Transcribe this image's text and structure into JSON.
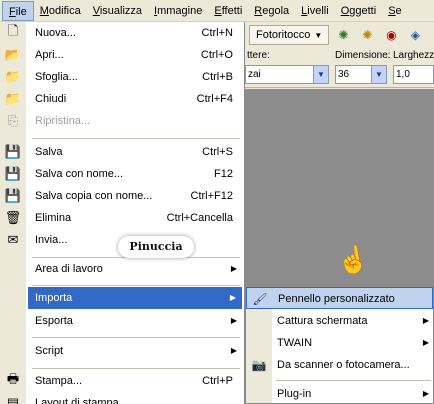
{
  "menubar": {
    "items": [
      "File",
      "Modifica",
      "Visualizza",
      "Immagine",
      "Effetti",
      "Regola",
      "Livelli",
      "Oggetti",
      "Se"
    ]
  },
  "toolbar": {
    "preset_dropdown": "Fotoritocco",
    "buttons": [
      "auto-contrast-icon",
      "auto-color-icon",
      "red-eye-icon",
      "clarify-icon"
    ]
  },
  "options_bar": {
    "charset_label": "ttere:",
    "charset_value": "zai",
    "size_label": "Dimensione:",
    "size_value": "36",
    "width_label": "Larghezza",
    "width_value": "1,0"
  },
  "file_menu": {
    "items": [
      {
        "label": "Nuova...",
        "shortcut": "Ctrl+N",
        "icon": "new-document-icon"
      },
      {
        "label": "Apri...",
        "shortcut": "Ctrl+O",
        "icon": "open-folder-icon"
      },
      {
        "label": "Sfoglia...",
        "shortcut": "Ctrl+B",
        "icon": "browse-folder-icon"
      },
      {
        "label": "Chiudi",
        "shortcut": "Ctrl+F4",
        "icon": "close-folder-icon"
      },
      {
        "label": "Ripristina...",
        "shortcut": "",
        "icon": "revert-icon"
      },
      {
        "label": "Salva",
        "shortcut": "Ctrl+S",
        "icon": "save-icon"
      },
      {
        "label": "Salva con nome...",
        "shortcut": "F12",
        "icon": "save-as-icon"
      },
      {
        "label": "Salva copia con nome...",
        "shortcut": "Ctrl+F12",
        "icon": "save-copy-icon"
      },
      {
        "label": "Elimina",
        "shortcut": "Ctrl+Cancella",
        "icon": "trash-icon"
      },
      {
        "label": "Invia...",
        "shortcut": "",
        "icon": "send-icon"
      },
      {
        "label": "Area di lavoro",
        "shortcut": "",
        "icon": ""
      },
      {
        "label": "Importa",
        "shortcut": "",
        "icon": ""
      },
      {
        "label": "Esporta",
        "shortcut": "",
        "icon": ""
      },
      {
        "label": "Script",
        "shortcut": "",
        "icon": ""
      },
      {
        "label": "Stampa...",
        "shortcut": "Ctrl+P",
        "icon": "printer-icon"
      },
      {
        "label": "Layout di stampa...",
        "shortcut": "",
        "icon": "print-layout-icon"
      }
    ]
  },
  "watermark": "Pinuccia",
  "import_submenu": {
    "items": [
      {
        "label": "Pennello personalizzato",
        "icon": "brush-icon"
      },
      {
        "label": "Cattura schermata",
        "icon": ""
      },
      {
        "label": "TWAIN",
        "icon": ""
      },
      {
        "label": "Da scanner o fotocamera...",
        "icon": "camera-icon"
      },
      {
        "label": "Plug-in",
        "icon": ""
      }
    ]
  }
}
